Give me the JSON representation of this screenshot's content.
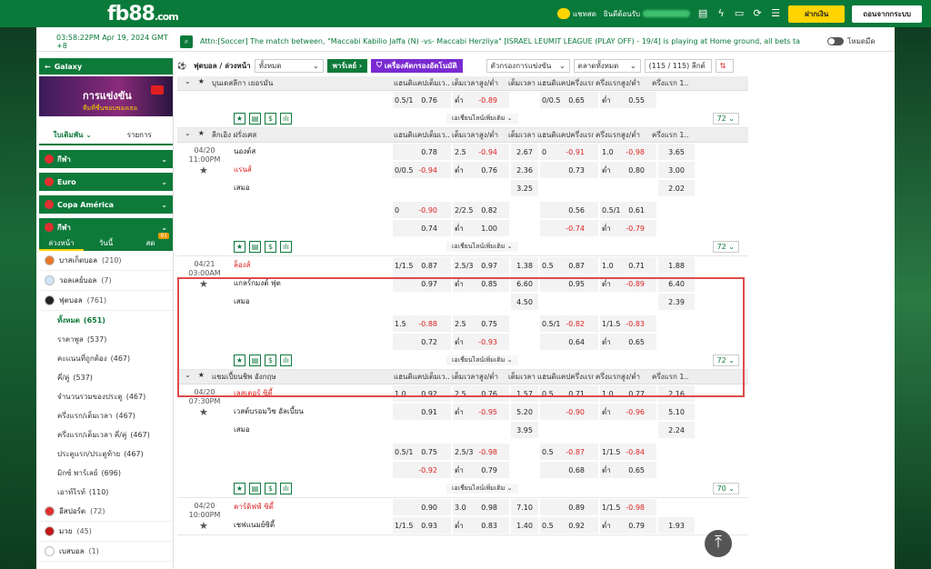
{
  "header": {
    "logo": "fb88",
    "logo_suffix": ".com",
    "chat": "แชทสด",
    "welcome": "ยินดีต้อนรับ",
    "deposit": "ฝากเงิน",
    "withdraw": "ถอนจากกระบบ"
  },
  "ticker": {
    "time": "03:58:22PM Apr 19, 2024 GMT +8",
    "message": "Attn:[Soccer] The match between, \"Maccabi Kabilio Jaffa (N) -vs- Maccabi Herzliya\" [ISRAEL LEUMIT LEAGUE (PLAY OFF) - 19/4] is playing at Home ground, all bets taken are",
    "mode": "โหมดมืด"
  },
  "sidebar": {
    "galaxy": "Galaxy",
    "banner_line1": "การแข่งขัน",
    "banner_line2": "ทีมที่ชื่นชอบของเธอ",
    "tab_bets": "ใบเดิมพัน",
    "tab_list": "รายการ",
    "cats": [
      {
        "label": "กีฬา",
        "color": "#e03030"
      },
      {
        "label": "Euro",
        "color": "#e03030"
      },
      {
        "label": "Copa América",
        "color": "#e03030"
      },
      {
        "label": "กีฬา",
        "color": "#e03030"
      }
    ],
    "subtabs": [
      "ล่วงหน้า",
      "วันนี้",
      "สด"
    ],
    "live_badge": "91",
    "sports": [
      {
        "label": "บาสเก็ตบอล",
        "count": "(210)",
        "color": "#e8762a"
      },
      {
        "label": "วอลเลย์บอล",
        "count": "(7)",
        "color": "#cfe4f7"
      },
      {
        "label": "ฟุตบอล",
        "count": "(761)",
        "color": "#222"
      }
    ],
    "football_items": [
      {
        "label": "ทั้งหมด",
        "count": "(651)"
      },
      {
        "label": "ราคาพูล",
        "count": "(537)"
      },
      {
        "label": "คะแนนที่ถูกต้อง",
        "count": "(467)"
      },
      {
        "label": "คี่/คู่",
        "count": "(537)"
      },
      {
        "label": "จำนวนรวมของประตู",
        "count": "(467)"
      },
      {
        "label": "ครึ่งแรก/เต็มเวลา",
        "count": "(467)"
      },
      {
        "label": "ครึ่งแรก/เต็มเวลา คี่/คู่",
        "count": "(467)"
      },
      {
        "label": "ประตูแรก/ประตูท้าย",
        "count": "(467)"
      },
      {
        "label": "มิกซ์ พาร์เลย์",
        "count": "(696)"
      },
      {
        "label": "เอาท์ไรท์",
        "count": "(110)"
      }
    ],
    "other_sports": [
      {
        "label": "อีสปอร์ต",
        "count": "(72)",
        "color": "#e03030"
      },
      {
        "label": "มวย",
        "count": "(45)",
        "color": "#c01818"
      },
      {
        "label": "เบสบอล",
        "count": "(1)",
        "color": "#ffffff"
      }
    ]
  },
  "filters": {
    "title": "ฟุตบอล / ล่วงหน้า",
    "all": "ทั้งหมด",
    "parlay": "พาร์เลย์",
    "filter_btn": "เครื่องคัดกรองอัตโนมัติ",
    "sort": "ตัวกรองการแข่งขัน",
    "market": "ตลาดทั้งหมด",
    "leagues": "(115 / 115) ลีกต์"
  },
  "columns": [
    "แฮนดิแคปเต็มเว...",
    "เต็มเวลาสูง/ต่ำ",
    "เต็มเวลา ...",
    "แฮนดิแคปครึ่งแรก",
    "ครึ่งแรกสูง/ต่ำ",
    "ครึ่งแรก 1..."
  ],
  "more_label": "เอเชี่ยนไลน์เพิ่มเติม",
  "leagues": [
    {
      "name": "บุนเดสลีกา เยอรมัน",
      "partial": true,
      "rows": [
        [
          "0.5/1",
          "0.76",
          "ต่ำ",
          "-0.89",
          "",
          "0/0.5",
          "0.65",
          "ต่ำ",
          "0.55",
          ""
        ]
      ],
      "count": "72"
    },
    {
      "name": "ลีกเอิง ฝรั่งเศส",
      "time": "04/20 11:00PM",
      "teams": [
        "นองต์ส",
        "แรนส์",
        "เสมอ"
      ],
      "rows": [
        [
          "",
          "0.78",
          "2.5",
          "-0.94",
          "2.67",
          "0",
          "-0.91",
          "1.0",
          "-0.98",
          "3.65"
        ],
        [
          "0/0.5",
          "-0.94",
          "ต่ำ",
          "0.76",
          "2.36",
          "",
          "0.73",
          "ต่ำ",
          "0.80",
          "3.00"
        ],
        [
          "",
          "",
          "",
          "",
          "3.25",
          "",
          "",
          "",
          "",
          "2.02"
        ],
        [
          "0",
          "-0.90",
          "2/2.5",
          "0.82",
          "",
          "",
          "0.56",
          "0.5/1",
          "0.61",
          ""
        ],
        [
          "",
          "0.74",
          "ต่ำ",
          "1.00",
          "",
          "",
          "-0.74",
          "ต่ำ",
          "-0.79",
          ""
        ]
      ],
      "count": "72"
    },
    {
      "name": "",
      "time": "04/21 03:00AM",
      "teams": [
        "ล็องส์",
        "แกลร์กมงต์ ฟุต",
        "เสมอ"
      ],
      "rows": [
        [
          "1/1.5",
          "0.87",
          "2.5/3",
          "0.97",
          "1.38",
          "0.5",
          "0.87",
          "1.0",
          "0.71",
          "1.88"
        ],
        [
          "",
          "0.97",
          "ต่ำ",
          "0.85",
          "6.60",
          "",
          "0.95",
          "ต่ำ",
          "-0.89",
          "6.40"
        ],
        [
          "",
          "",
          "",
          "",
          "4.50",
          "",
          "",
          "",
          "",
          "2.39"
        ],
        [
          "1.5",
          "-0.88",
          "2.5",
          "0.75",
          "",
          "0.5/1",
          "-0.82",
          "1/1.5",
          "-0.83",
          ""
        ],
        [
          "",
          "0.72",
          "ต่ำ",
          "-0.93",
          "",
          "",
          "0.64",
          "ต่ำ",
          "0.65",
          ""
        ]
      ],
      "count": "72"
    },
    {
      "name": "แชมเปี้ยนชิพ อังกฤษ",
      "time": "04/20 07:30PM",
      "teams": [
        "เลสเตอร์ ซิตี้",
        "เวสต์บรอมวิช อัลเบี้ยน",
        "เสมอ"
      ],
      "rows": [
        [
          "1.0",
          "0.92",
          "2.5",
          "0.76",
          "1.57",
          "0.5",
          "0.71",
          "1.0",
          "0.77",
          "2.16"
        ],
        [
          "",
          "0.91",
          "ต่ำ",
          "-0.95",
          "5.20",
          "",
          "-0.90",
          "ต่ำ",
          "-0.96",
          "5.10"
        ],
        [
          "",
          "",
          "",
          "",
          "3.95",
          "",
          "",
          "",
          "",
          "2.24"
        ],
        [
          "0.5/1",
          "0.75",
          "2.5/3",
          "-0.98",
          "",
          "0.5",
          "-0.87",
          "1/1.5",
          "-0.84",
          ""
        ],
        [
          "",
          "-0.92",
          "ต่ำ",
          "0.79",
          "",
          "",
          "0.68",
          "ต่ำ",
          "0.65",
          ""
        ]
      ],
      "count": "70"
    },
    {
      "name": "",
      "time": "04/20 10:00PM",
      "teams": [
        "คาร์ดิฟฟ์ ซิตี้",
        "เชฟแนมย์ซิตี้"
      ],
      "rows": [
        [
          "",
          "0.90",
          "3.0",
          "0.98",
          "7.10",
          "",
          "0.89",
          "1/1.5",
          "-0.98",
          ""
        ],
        [
          "1/1.5",
          "0.93",
          "ต่ำ",
          "0.83",
          "1.40",
          "0.5",
          "0.92",
          "ต่ำ",
          "0.79",
          "1.93"
        ]
      ],
      "count": ""
    }
  ]
}
